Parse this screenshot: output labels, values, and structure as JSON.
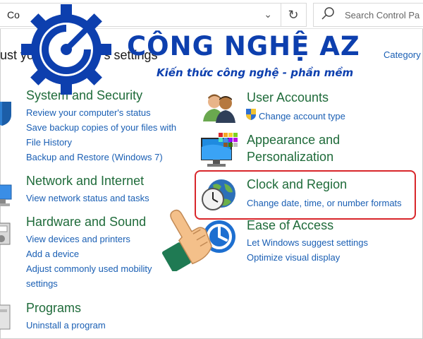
{
  "address_bar": {
    "crumb": "Co",
    "search_placeholder": "Search Control Pa"
  },
  "heading": "just your computer's settings",
  "view_by": "Category ▾",
  "watermark": {
    "brand": "CÔNG NGHỆ AZ",
    "tagline": "Kiến thức công nghệ - phần mềm"
  },
  "left_categories": [
    {
      "title": "System and Security",
      "links": [
        "Review your computer's status",
        "Save backup copies of your files with File History",
        "Backup and Restore (Windows 7)"
      ]
    },
    {
      "title": "Network and Internet",
      "links": [
        "View network status and tasks"
      ]
    },
    {
      "title": "Hardware and Sound",
      "links": [
        "View devices and printers",
        "Add a device",
        "Adjust commonly used mobility settings"
      ]
    },
    {
      "title": "Programs",
      "links": [
        "Uninstall a program"
      ]
    }
  ],
  "right_categories": [
    {
      "title": "User Accounts",
      "links": [
        "Change account type"
      ]
    },
    {
      "title": "Appearance and Personalization",
      "links": []
    },
    {
      "title": "Clock and Region",
      "links": [
        "Change date, time, or number formats"
      ]
    },
    {
      "title": "Ease of Access",
      "links": [
        "Let Windows suggest settings",
        "Optimize visual display"
      ]
    }
  ],
  "colors": {
    "category_title": "#1f6b3a",
    "link": "#1a5fb4",
    "highlight_border": "#d8262b",
    "watermark": "#0d3fae"
  }
}
